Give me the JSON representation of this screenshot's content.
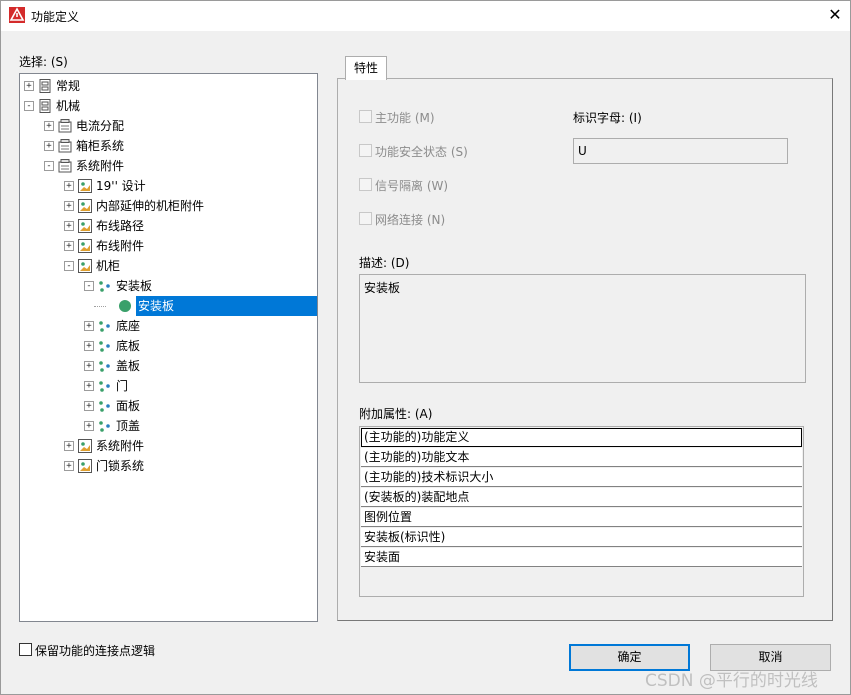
{
  "window": {
    "title": "功能定义",
    "close_glyph": "✕"
  },
  "tree": {
    "label": "选择: (S)",
    "nodes": [
      {
        "label": "常规",
        "icon": "cabinet-icon",
        "expander": "+",
        "level": 0
      },
      {
        "label": "机械",
        "icon": "cabinet-icon",
        "expander": "−",
        "level": 0
      },
      {
        "label": "电流分配",
        "icon": "box-icon",
        "expander": "+",
        "level": 1
      },
      {
        "label": "箱柜系统",
        "icon": "box-icon",
        "expander": "+",
        "level": 1
      },
      {
        "label": "系统附件",
        "icon": "box-icon",
        "expander": "−",
        "level": 1
      },
      {
        "label": "19'' 设计",
        "icon": "picture-icon",
        "expander": "+",
        "level": 2
      },
      {
        "label": "内部延伸的机柜附件",
        "icon": "picture-icon",
        "expander": "+",
        "level": 2
      },
      {
        "label": "布线路径",
        "icon": "picture-icon",
        "expander": "+",
        "level": 2
      },
      {
        "label": "布线附件",
        "icon": "picture-icon",
        "expander": "+",
        "level": 2
      },
      {
        "label": "机柜",
        "icon": "picture-icon",
        "expander": "−",
        "level": 2
      },
      {
        "label": "安装板",
        "icon": "dots-icon",
        "expander": "−",
        "level": 3
      },
      {
        "label": "安装板",
        "icon": "green-dot-icon",
        "expander": "",
        "level": 4,
        "selected": true
      },
      {
        "label": "底座",
        "icon": "dots-icon",
        "expander": "+",
        "level": 3
      },
      {
        "label": "底板",
        "icon": "dots-icon",
        "expander": "+",
        "level": 3
      },
      {
        "label": "盖板",
        "icon": "dots-icon",
        "expander": "+",
        "level": 3
      },
      {
        "label": "门",
        "icon": "dots-icon",
        "expander": "+",
        "level": 3
      },
      {
        "label": "面板",
        "icon": "dots-icon",
        "expander": "+",
        "level": 3
      },
      {
        "label": "顶盖",
        "icon": "dots-icon",
        "expander": "+",
        "level": 3
      },
      {
        "label": "系统附件",
        "icon": "picture-icon",
        "expander": "+",
        "level": 2
      },
      {
        "label": "门锁系统",
        "icon": "picture-icon",
        "expander": "+",
        "level": 2
      }
    ]
  },
  "tab": {
    "label": "特性"
  },
  "properties": {
    "main_function": "主功能 (M)",
    "safety_state": "功能安全状态 (S)",
    "signal_isolation": "信号隔离 (W)",
    "network_connection": "网络连接 (N)",
    "id_letter_label": "标识字母: (I)",
    "id_letter_value": "U",
    "description_label": "描述: (D)",
    "description_value": "安装板",
    "extra_attrs_label": "附加属性: (A)",
    "extra_attrs": [
      "(主功能的)功能定义",
      "(主功能的)功能文本",
      "(主功能的)技术标识大小",
      "(安装板的)装配地点",
      "图例位置",
      "安装板(标识性)",
      "安装面"
    ]
  },
  "footer": {
    "keep_logic_label": "保留功能的连接点逻辑",
    "ok_label": "确定",
    "cancel_label": "取消",
    "watermark": "CSDN @平行的时光线"
  },
  "colors": {
    "selection": "#0078d7",
    "accent_red": "#d42b2b",
    "green": "#3aa06a"
  }
}
